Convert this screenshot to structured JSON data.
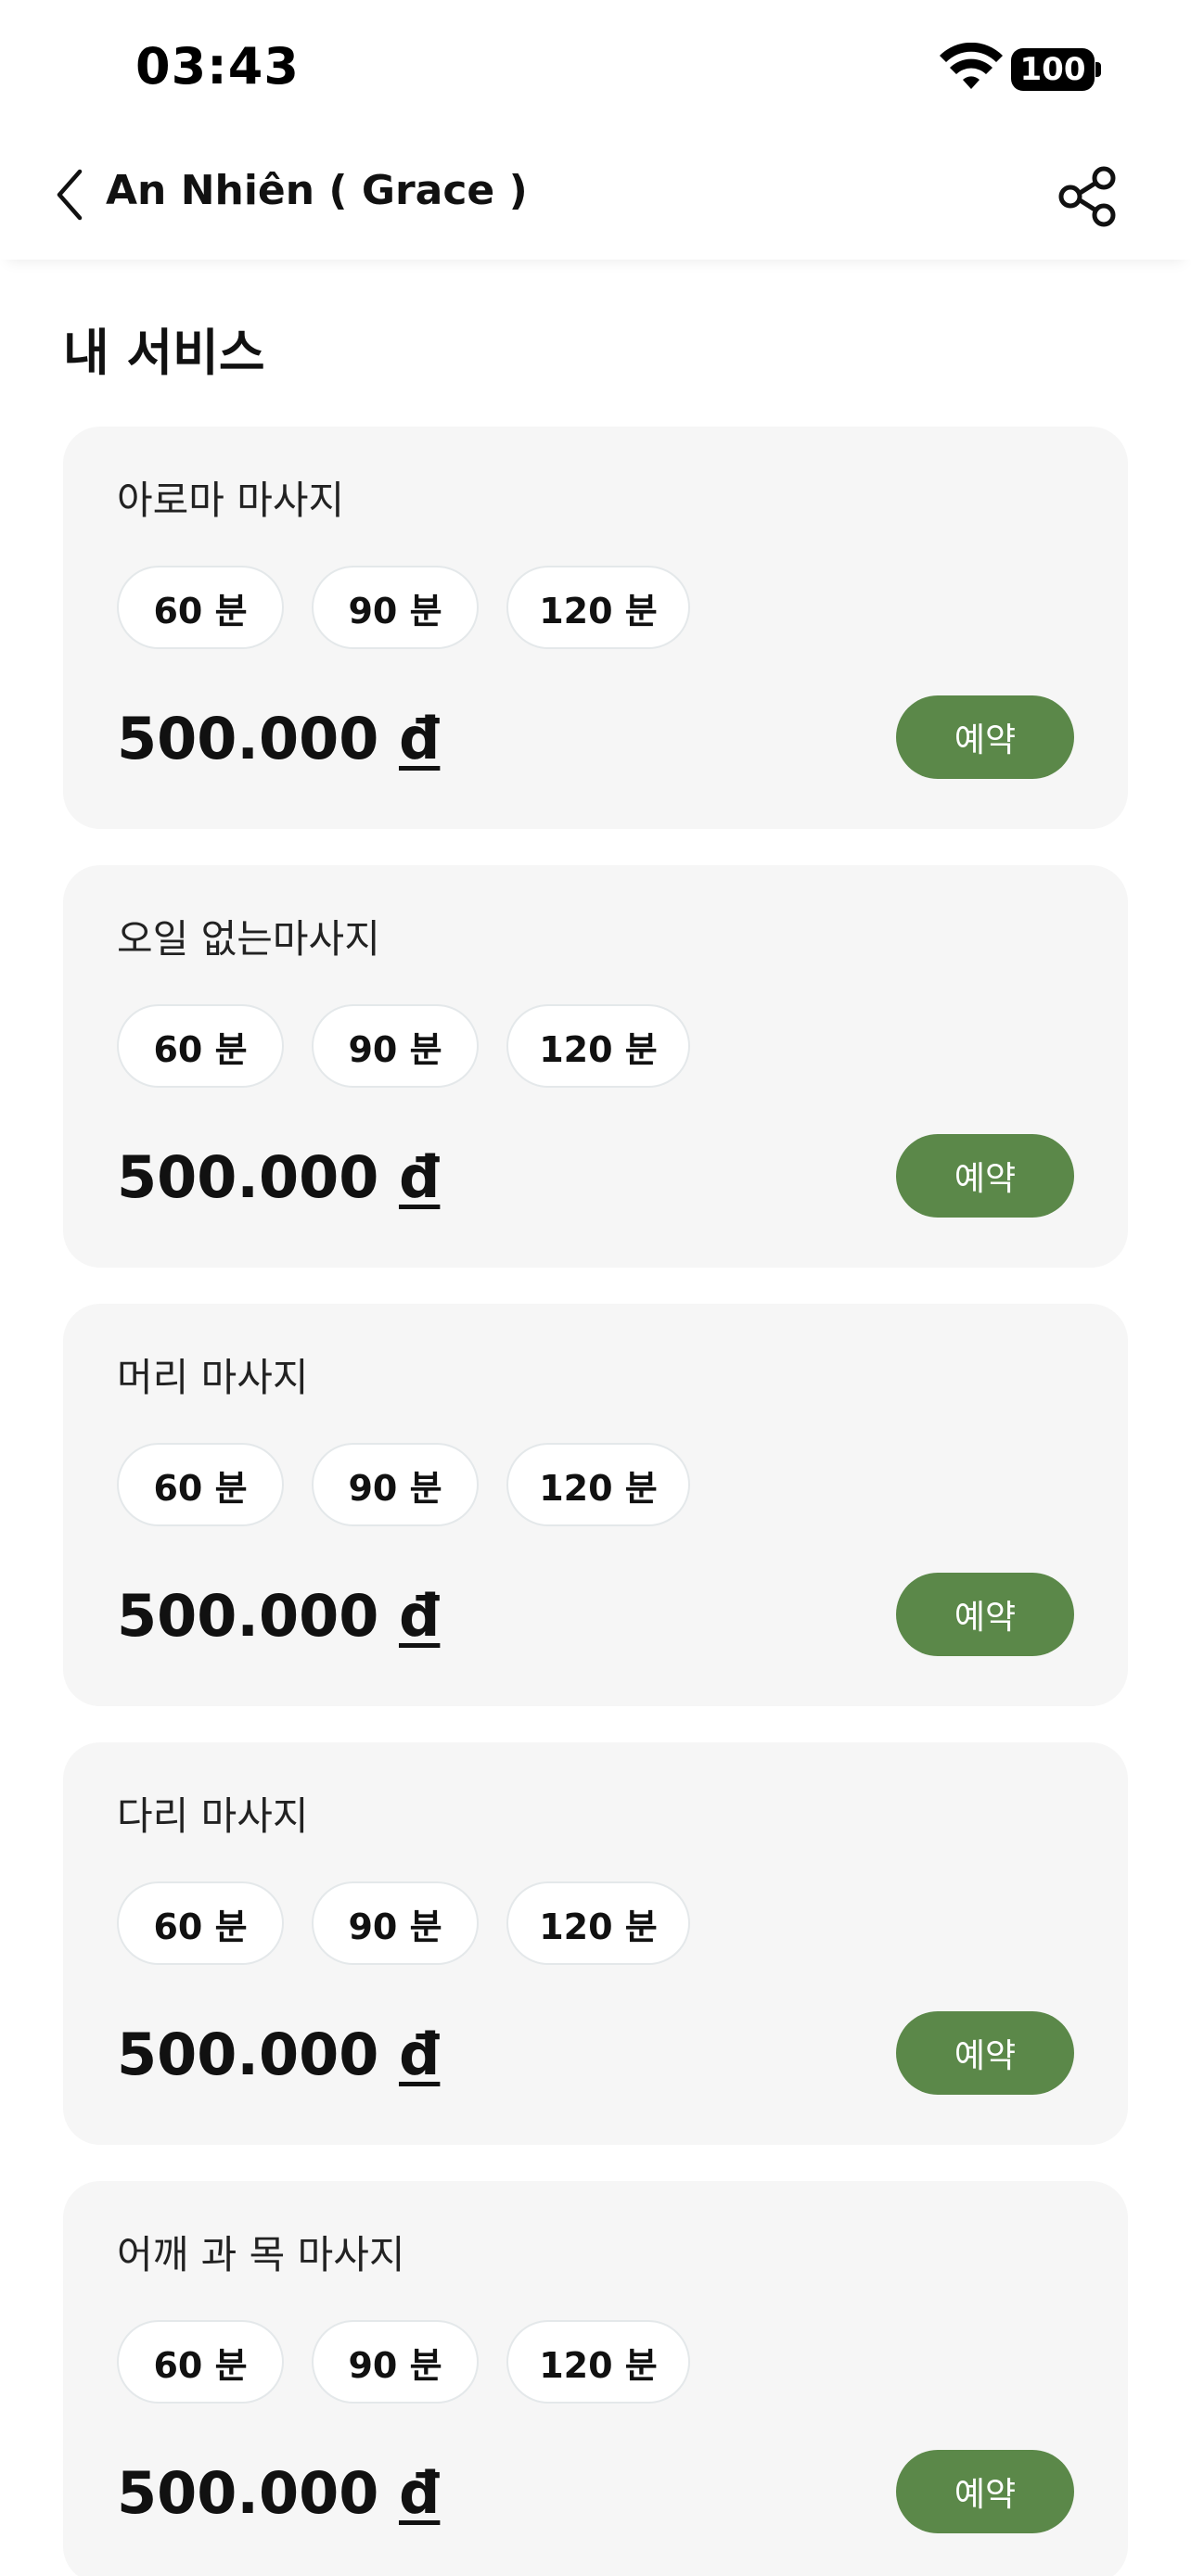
{
  "status_bar": {
    "time": "03:43",
    "battery": "100",
    "icons": [
      "wifi-icon",
      "battery-icon"
    ]
  },
  "header": {
    "title": "An Nhiên ( Grace )",
    "back_icon": "chevron-left-icon",
    "share_icon": "share-icon"
  },
  "section_title": "내 서비스",
  "currency_symbol": "đ",
  "services": [
    {
      "name": "아로마 마사지",
      "durations": [
        "60 분",
        "90 분",
        "120 분"
      ],
      "price": "500.000",
      "currency": "đ",
      "book_label": "예약"
    },
    {
      "name": "오일 없는마사지",
      "durations": [
        "60 분",
        "90 분",
        "120 분"
      ],
      "price": "500.000",
      "currency": "đ",
      "book_label": "예약"
    },
    {
      "name": "머리 마사지",
      "durations": [
        "60 분",
        "90 분",
        "120 분"
      ],
      "price": "500.000",
      "currency": "đ",
      "book_label": "예약"
    },
    {
      "name": "다리 마사지",
      "durations": [
        "60 분",
        "90 분",
        "120 분"
      ],
      "price": "500.000",
      "currency": "đ",
      "book_label": "예약"
    },
    {
      "name": "어깨 과 목 마사지",
      "durations": [
        "60 분",
        "90 분",
        "120 분"
      ],
      "price": "500.000",
      "currency": "đ",
      "book_label": "예약"
    }
  ],
  "colors": {
    "accent": "#5b8849",
    "card_background": "#f6f6f6",
    "chip_border": "#e4e8ea"
  }
}
